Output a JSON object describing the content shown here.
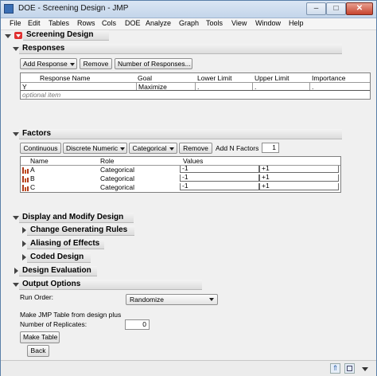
{
  "window": {
    "title": "DOE - Screening Design - JMP",
    "minimize": "–",
    "maximize": "□",
    "close": "✕"
  },
  "menu": [
    "File",
    "Edit",
    "Tables",
    "Rows",
    "Cols",
    "DOE",
    "Analyze",
    "Graph",
    "Tools",
    "View",
    "Window",
    "Help"
  ],
  "report": {
    "title": "Screening Design"
  },
  "responses": {
    "title": "Responses",
    "buttons": {
      "add": "Add Response",
      "remove": "Remove",
      "number": "Number of Responses..."
    },
    "headers": [
      "Response Name",
      "Goal",
      "Lower Limit",
      "Upper Limit",
      "Importance"
    ],
    "rows": [
      {
        "name": "Y",
        "goal": "Maximize",
        "lower": ".",
        "upper": ".",
        "importance": "."
      }
    ],
    "optional": "optional item"
  },
  "factors": {
    "title": "Factors",
    "buttons": {
      "continuous": "Continuous",
      "discrete": "Discrete Numeric",
      "categorical": "Categorical",
      "remove": "Remove"
    },
    "add_n_label": "Add N Factors",
    "add_n_value": "1",
    "headers": [
      "Name",
      "Role",
      "Values"
    ],
    "rows": [
      {
        "name": "A",
        "role": "Categorical",
        "v1": "-1",
        "v2": "+1"
      },
      {
        "name": "B",
        "role": "Categorical",
        "v1": "-1",
        "v2": "+1"
      },
      {
        "name": "C",
        "role": "Categorical",
        "v1": "-1",
        "v2": "+1"
      }
    ]
  },
  "display_modify": {
    "title": "Display and Modify Design",
    "items": [
      "Change Generating Rules",
      "Aliasing of Effects",
      "Coded Design"
    ]
  },
  "design_evaluation": {
    "title": "Design Evaluation"
  },
  "output": {
    "title": "Output Options",
    "run_order_label": "Run Order:",
    "run_order_value": "Randomize",
    "make_table_text": "Make JMP Table from design plus",
    "replicates_label": "Number of Replicates:",
    "replicates_value": "0",
    "make_table_button": "Make Table",
    "back_button": "Back"
  }
}
